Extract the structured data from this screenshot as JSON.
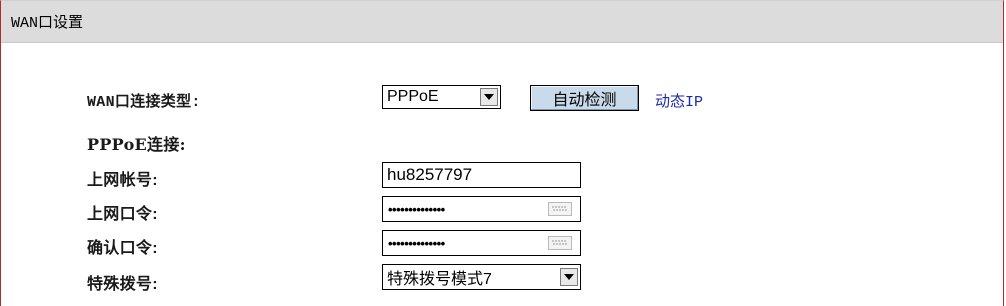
{
  "header": {
    "title": "WAN口设置"
  },
  "form": {
    "connection_type_label": "WAN口连接类型:",
    "connection_type_value": "PPPoE",
    "auto_detect_label": "自动检测",
    "detect_status": "动态IP",
    "pppoe_section_label": "PPPoE连接:",
    "account_label": "上网帐号:",
    "account_value": "hu8257797",
    "password_label": "上网口令:",
    "password_value": "••••••••••••••",
    "confirm_label": "确认口令:",
    "confirm_value": "••••••••••••••",
    "dial_label": "特殊拨号:",
    "dial_value": "特殊拨号模式7"
  },
  "icons": {
    "dropdown": "chevron-down-icon",
    "keyboard": "keyboard-icon"
  },
  "colors": {
    "panel_border": "#b22a2a",
    "header_bg": "#dcdcdc",
    "button_bg": "#c9dbea",
    "status_text": "#1a2aa8"
  }
}
